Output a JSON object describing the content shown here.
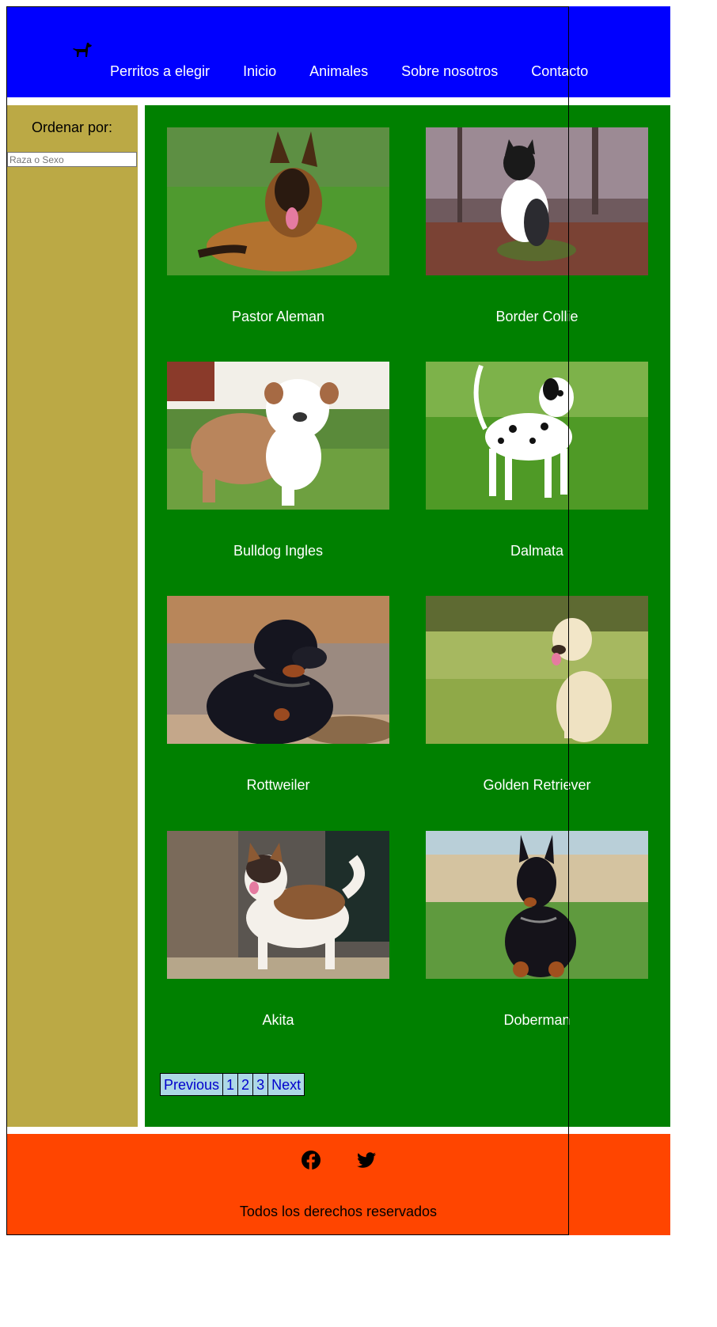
{
  "header": {
    "logo_icon": "dog-icon",
    "nav": [
      {
        "label": "Perritos a elegir"
      },
      {
        "label": "Inicio"
      },
      {
        "label": "Animales"
      },
      {
        "label": "Sobre nosotros"
      },
      {
        "label": "Contacto"
      }
    ]
  },
  "sidebar": {
    "sort_label": "Ordenar por:",
    "sort_placeholder": "Raza o Sexo"
  },
  "dogs": [
    {
      "name": "Pastor Aleman",
      "photo_icon": "german-shepherd-photo"
    },
    {
      "name": "Border Collie",
      "photo_icon": "border-collie-photo"
    },
    {
      "name": "Bulldog Ingles",
      "photo_icon": "bulldog-photo"
    },
    {
      "name": "Dalmata",
      "photo_icon": "dalmatian-photo"
    },
    {
      "name": "Rottweiler",
      "photo_icon": "rottweiler-photo"
    },
    {
      "name": "Golden Retriever",
      "photo_icon": "golden-retriever-photo"
    },
    {
      "name": "Akita",
      "photo_icon": "akita-photo"
    },
    {
      "name": "Doberman",
      "photo_icon": "doberman-photo"
    }
  ],
  "pagination": {
    "previous": "Previous",
    "pages": [
      "1",
      "2",
      "3"
    ],
    "next": "Next"
  },
  "footer": {
    "social_icons": [
      "facebook-icon",
      "twitter-icon"
    ],
    "copyright": "Todos los derechos reservados"
  },
  "colors": {
    "header_bg": "#0000ff",
    "sidebar_bg": "#bba945",
    "main_bg": "#008000",
    "footer_bg": "#ff4500",
    "pager_bg": "#add8e6"
  }
}
